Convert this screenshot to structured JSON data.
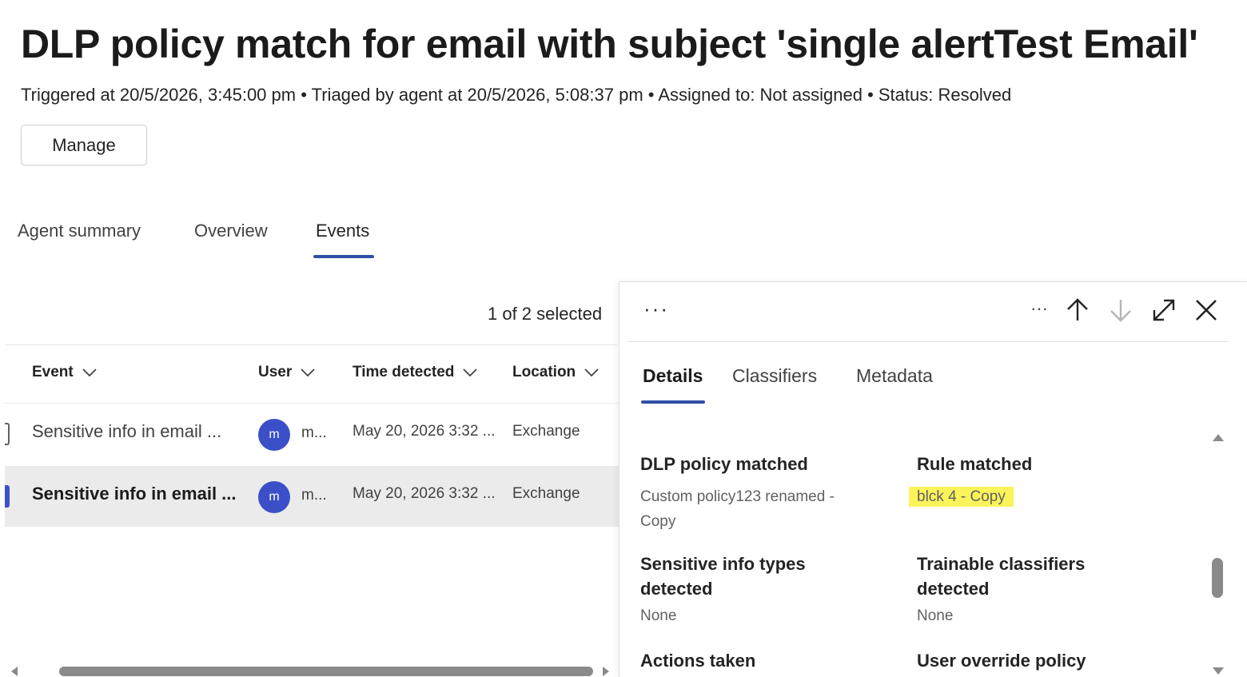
{
  "page": {
    "title": "DLP policy match for email with subject 'single alertTest Email'",
    "subtitle": "Triggered at 20/5/2026, 3:45:00 pm • Triaged by agent at 20/5/2026, 5:08:37 pm • Assigned to: Not assigned • Status: Resolved",
    "manage_label": "Manage"
  },
  "tabs": [
    {
      "label": "Agent summary"
    },
    {
      "label": "Overview"
    },
    {
      "label": "Events",
      "active": true
    }
  ],
  "events": {
    "selected_count": "1 of 2 selected",
    "columns": [
      "Event",
      "User",
      "Time detected",
      "Location"
    ],
    "rows": [
      {
        "event": "Sensitive info in email ...",
        "avatar": "m",
        "user": "m...",
        "time": "May 20, 2026 3:32 ...",
        "location": "Exchange",
        "selected": false
      },
      {
        "event": "Sensitive info in email ...",
        "avatar": "m",
        "user": "m...",
        "time": "May 20, 2026 3:32 ...",
        "location": "Exchange",
        "selected": true
      }
    ]
  },
  "details_panel": {
    "more_label": "···",
    "toolbar_more_label": "···",
    "icons": [
      "more-icon",
      "arrow-up-icon",
      "arrow-down-icon",
      "expand-icon",
      "close-icon"
    ],
    "tabs": [
      {
        "label": "Details",
        "active": true
      },
      {
        "label": "Classifiers"
      },
      {
        "label": "Metadata"
      }
    ],
    "fields": {
      "dlp_policy_matched": {
        "label": "DLP policy matched",
        "value": "Custom policy123 renamed - Copy"
      },
      "rule_matched": {
        "label": "Rule matched",
        "value": "blck 4 - Copy"
      },
      "sensitive_info_types": {
        "label": "Sensitive info types detected",
        "value": "None"
      },
      "trainable_classifiers": {
        "label": "Trainable classifiers detected",
        "value": "None"
      },
      "actions_taken": {
        "label": "Actions taken"
      },
      "user_override_policy": {
        "label": "User override policy"
      }
    }
  },
  "colors": {
    "accent": "#2f4ea8",
    "avatar": "#3b4fc8",
    "highlight": "#fbf35a",
    "selected_row": "#ebebeb"
  }
}
